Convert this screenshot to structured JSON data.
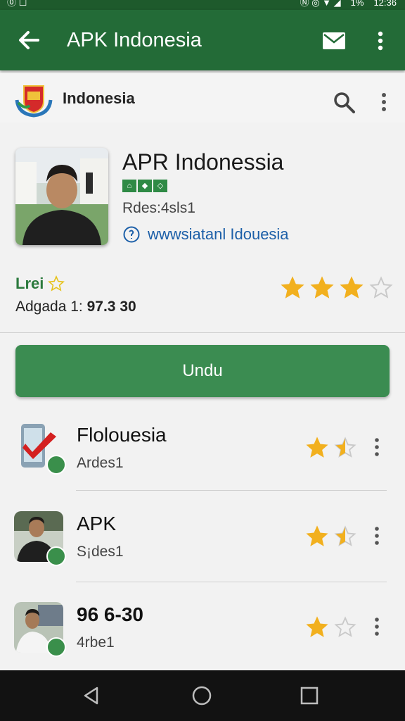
{
  "status_bar": {
    "left": "⓪ ☐",
    "right_icons": "Ⓝ ◎ ▼ ◢",
    "battery": "1%",
    "time": "12:36"
  },
  "appbar": {
    "title": "APK Indonesia",
    "icons": [
      "back-arrow-icon",
      "mail-icon",
      "more-vert-icon"
    ]
  },
  "publisher": {
    "name": "Indonesia"
  },
  "app": {
    "name": "APR Indonessia",
    "badges": [
      "⌂",
      "◆",
      "◇"
    ],
    "subtitle": "Rdes:4sls1",
    "link": "wwwsiatanl Idouesia",
    "label": "Lrei",
    "aggregate_label": "Adgada 1:",
    "aggregate_value": "97.3 30",
    "rating_stars": 3,
    "rating_max": 4
  },
  "download_button": {
    "label": "Undu"
  },
  "list": [
    {
      "title": "Flolouesia",
      "subtitle": "Ardes1",
      "rating": 1.5,
      "max": 2
    },
    {
      "title": "APK",
      "subtitle": "S¡des1",
      "rating": 1.5,
      "max": 2
    },
    {
      "title": "96 6-30",
      "subtitle": "4rbe1",
      "rating": 1,
      "max": 2
    }
  ],
  "colors": {
    "appbar": "#236b37",
    "button": "#3b8c51",
    "star": "#f2b01e",
    "link": "#1c5fa8"
  }
}
